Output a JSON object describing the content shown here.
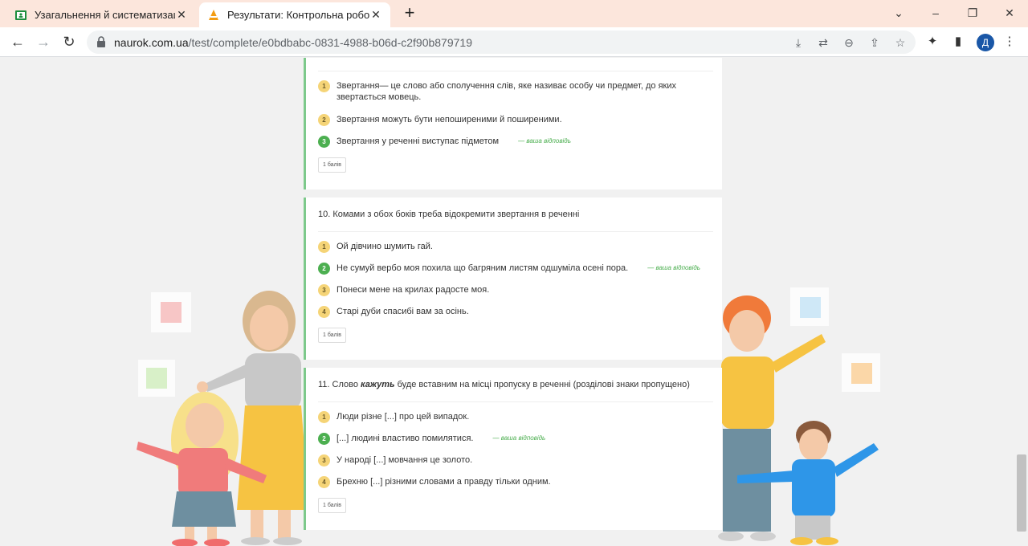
{
  "browser": {
    "tabs": [
      {
        "title": "Узагальнення й систематизація",
        "active": false
      },
      {
        "title": "Результати: Контрольна робота",
        "active": true
      }
    ],
    "url_host": "naurok.com.ua",
    "url_path": "/test/complete/e0bdbabc-0831-4988-b06d-c2f90b879719",
    "profile_initial": "Д"
  },
  "questions": [
    {
      "title": "",
      "answers": [
        {
          "num": "1",
          "text": "Звертання— це слово або сполучення слів, яке називає особу чи предмет, до яких звертається мовець.",
          "correct": false,
          "yours": ""
        },
        {
          "num": "2",
          "text": "Звертання можуть бути непоширеними й поширеними.",
          "correct": false,
          "yours": ""
        },
        {
          "num": "3",
          "text": "Звертання у реченні виступає підметом",
          "correct": true,
          "yours": "— ваша відповідь"
        }
      ],
      "points": "1 балів"
    },
    {
      "title": "10. Комами з обох боків треба відокремити звертання в реченні",
      "answers": [
        {
          "num": "1",
          "text": "Ой дівчино шумить гай.",
          "correct": false,
          "yours": ""
        },
        {
          "num": "2",
          "text": "Не сумуй вербо моя похила що багряним листям одшуміла осені пора.",
          "correct": true,
          "yours": "— ваша відповідь"
        },
        {
          "num": "3",
          "text": "Понеси мене на крилах радосте моя.",
          "correct": false,
          "yours": ""
        },
        {
          "num": "4",
          "text": "Старі дуби спасибі вам за осінь.",
          "correct": false,
          "yours": ""
        }
      ],
      "points": "1 балів"
    },
    {
      "title_prefix": "11. Слово ",
      "title_word": "кажуть",
      "title_suffix": " буде вставним на місці пропуску в реченні (розділові знаки пропущено)",
      "answers": [
        {
          "num": "1",
          "text": "Люди різне [...] про цей випадок.",
          "correct": false,
          "yours": ""
        },
        {
          "num": "2",
          "text": "[...] людині властиво помилятися.",
          "correct": true,
          "yours": "— ваша відповідь"
        },
        {
          "num": "3",
          "text": "У народі [...] мовчання це золото.",
          "correct": false,
          "yours": ""
        },
        {
          "num": "4",
          "text": "Брехню [...] різними словами а правду тільки одним.",
          "correct": false,
          "yours": ""
        }
      ],
      "points": "1 балів"
    }
  ],
  "colors": {
    "correct": "#4caf50",
    "option_badge": "#f5d477",
    "card_accent": "#7dc98b"
  }
}
